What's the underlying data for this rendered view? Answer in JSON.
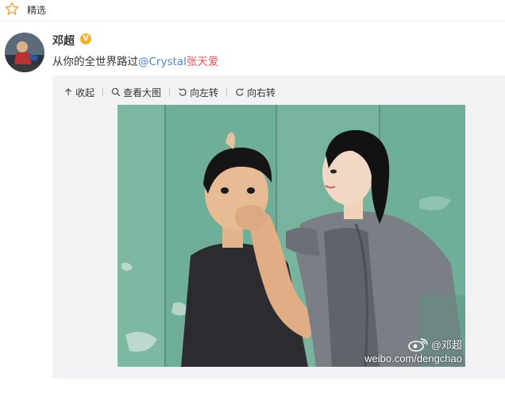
{
  "header": {
    "tab_label": "精选",
    "icon": "star-icon"
  },
  "post": {
    "author": "邓超",
    "verified_badge": "V",
    "text_prefix": "从你的全世界路过",
    "mention": "@Crystal",
    "name_link": "张天爱"
  },
  "toolbar": {
    "collapse": "收起",
    "view_large": "查看大图",
    "rotate_left": "向左转",
    "rotate_right": "向右转"
  },
  "photo": {
    "watermark_handle": "@邓超",
    "watermark_url": "weibo.com/dengchao"
  },
  "colors": {
    "mention": "#4a86c6",
    "name_link": "#e05a5a",
    "verified": "#f0b22a",
    "wall": "#6fae98"
  }
}
